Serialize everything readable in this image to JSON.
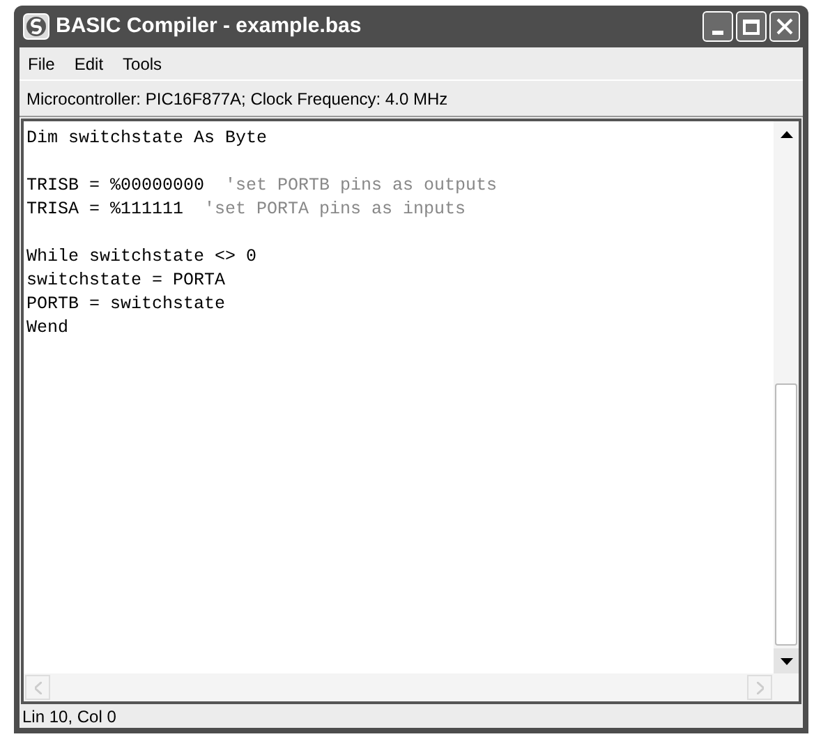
{
  "window": {
    "title": "BASIC Compiler - example.bas"
  },
  "menu": [
    "File",
    "Edit",
    "Tools"
  ],
  "info_bar": "Microcontroller: PIC16F877A;  Clock Frequency: 4.0 MHz",
  "editor": {
    "lines": [
      {
        "kind": "code",
        "code": "Dim switchstate As Byte"
      },
      {
        "kind": "blank"
      },
      {
        "kind": "code",
        "code": "TRISB = %00000000  ",
        "comment": "'set PORTB pins as outputs"
      },
      {
        "kind": "code",
        "code": "TRISA = %111111  ",
        "comment": "'set PORTA pins as inputs"
      },
      {
        "kind": "blank"
      },
      {
        "kind": "code",
        "code": "While switchstate <> 0"
      },
      {
        "kind": "code",
        "code": "switchstate = PORTA"
      },
      {
        "kind": "code",
        "code": "PORTB = switchstate"
      },
      {
        "kind": "code",
        "code": "Wend"
      }
    ]
  },
  "status_bar": "Lin 10, Col 0"
}
